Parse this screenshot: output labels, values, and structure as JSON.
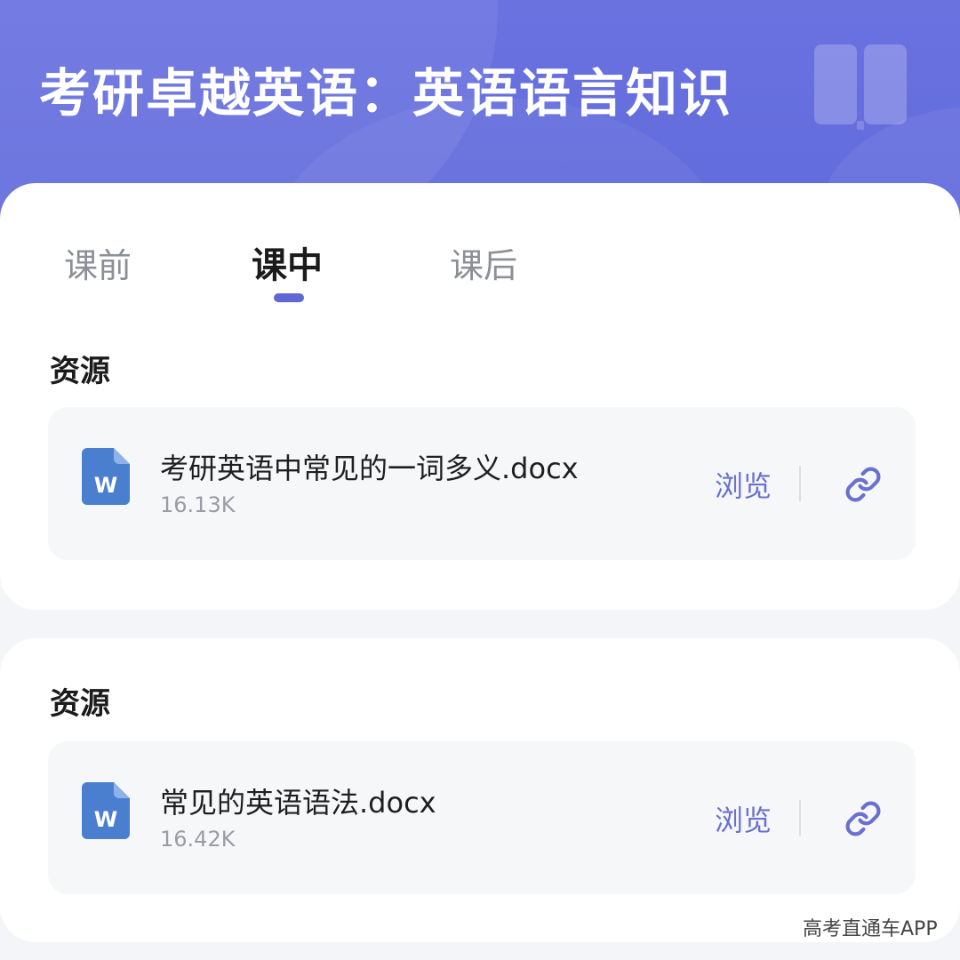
{
  "header": {
    "title": "考研卓越英语：英语语言知识",
    "book_icon": "book-icon"
  },
  "tabs": [
    {
      "label": "课前",
      "active": false
    },
    {
      "label": "课中",
      "active": true
    },
    {
      "label": "课后",
      "active": false
    }
  ],
  "sections": [
    {
      "title": "资源",
      "files": [
        {
          "name": "考研英语中常见的一词多义.docx",
          "size": "16.13K",
          "file_icon": "word-doc-icon",
          "browse_label": "浏览",
          "link_icon": "link-icon"
        }
      ]
    },
    {
      "title": "资源",
      "files": [
        {
          "name": "常见的英语语法.docx",
          "size": "16.42K",
          "file_icon": "word-doc-icon",
          "browse_label": "浏览",
          "link_icon": "link-icon"
        }
      ]
    }
  ],
  "watermark": "高考直通车APP",
  "colors": {
    "header_bg": "#626bdc",
    "accent": "#5f67d6",
    "link_text": "#6a70cf",
    "word_icon": "#4a7fd0",
    "card_bg": "#ffffff",
    "item_bg": "#f6f7f9"
  }
}
